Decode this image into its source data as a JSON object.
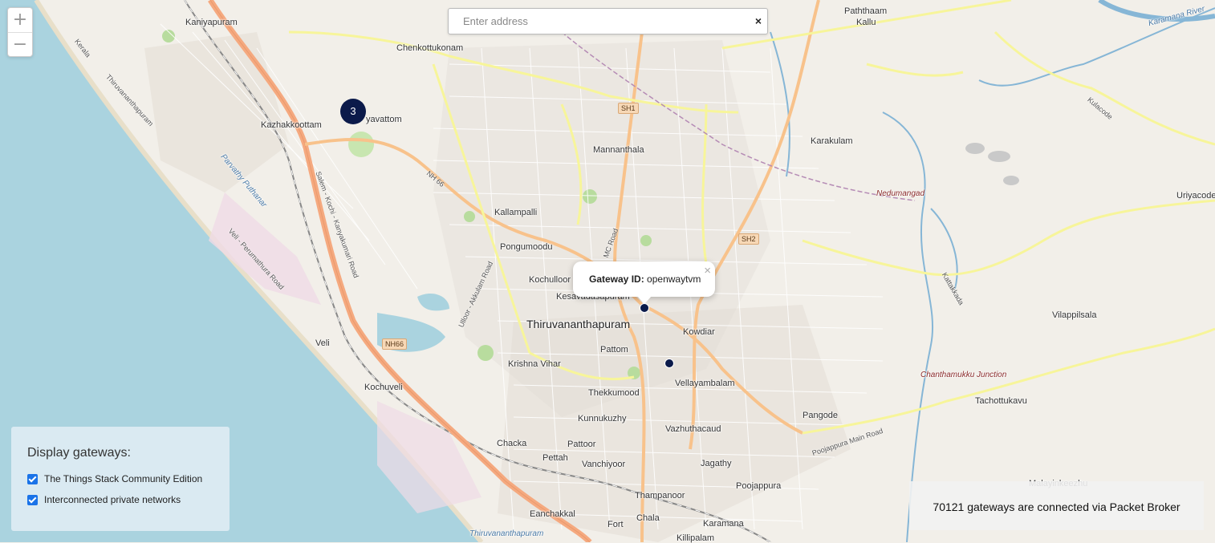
{
  "map": {
    "colors": {
      "land": "#f2efe9",
      "sea": "#aad3df",
      "major_road": "#f5a97f",
      "secondary_road": "#f7f59a",
      "river": "#86b6d6",
      "marker": "#0b1a4a"
    },
    "places": [
      {
        "name": "Kaniyapuram",
        "cls": ""
      },
      {
        "name": "Chenkottukonam",
        "cls": ""
      },
      {
        "name": "Paththaam",
        "cls": ""
      },
      {
        "name": "Kallu",
        "cls": ""
      },
      {
        "name": "Kazhakkoottam",
        "cls": ""
      },
      {
        "name": "yavattom",
        "cls": ""
      },
      {
        "name": "Mannanthala",
        "cls": ""
      },
      {
        "name": "Karakulam",
        "cls": ""
      },
      {
        "name": "Nedumangad",
        "cls": "small-italic"
      },
      {
        "name": "Uriyacode",
        "cls": ""
      },
      {
        "name": "Kallampalli",
        "cls": ""
      },
      {
        "name": "Pongumoodu",
        "cls": ""
      },
      {
        "name": "Kochulloor",
        "cls": ""
      },
      {
        "name": "Kesavadasapuram",
        "cls": ""
      },
      {
        "name": "Thiruvananthapuram",
        "cls": "city"
      },
      {
        "name": "Kowdiar",
        "cls": ""
      },
      {
        "name": "Pattom",
        "cls": ""
      },
      {
        "name": "Veli",
        "cls": ""
      },
      {
        "name": "Krishna Vihar",
        "cls": ""
      },
      {
        "name": "Vilappilsala",
        "cls": ""
      },
      {
        "name": "Vellayambalam",
        "cls": ""
      },
      {
        "name": "Kochuveli",
        "cls": ""
      },
      {
        "name": "Thekkumood",
        "cls": ""
      },
      {
        "name": "Chanthamukku Junction",
        "cls": "small-italic"
      },
      {
        "name": "Tachottukavu",
        "cls": ""
      },
      {
        "name": "Kunnukuzhy",
        "cls": ""
      },
      {
        "name": "Pangode",
        "cls": ""
      },
      {
        "name": "Vazhuthacaud",
        "cls": ""
      },
      {
        "name": "Chacka",
        "cls": ""
      },
      {
        "name": "Pattoor",
        "cls": ""
      },
      {
        "name": "Pettah",
        "cls": ""
      },
      {
        "name": "Vanchiyoor",
        "cls": ""
      },
      {
        "name": "Jagathy",
        "cls": ""
      },
      {
        "name": "Poojappura",
        "cls": ""
      },
      {
        "name": "Malayinkeezhu",
        "cls": ""
      },
      {
        "name": "Thampanoor",
        "cls": ""
      },
      {
        "name": "Eanchakkal",
        "cls": ""
      },
      {
        "name": "Fort",
        "cls": ""
      },
      {
        "name": "Chala",
        "cls": ""
      },
      {
        "name": "Karamana",
        "cls": ""
      },
      {
        "name": "Killipalam",
        "cls": ""
      },
      {
        "name": "Parvathy Puthanar",
        "cls": "water"
      },
      {
        "name": "Karamana River",
        "cls": "water"
      },
      {
        "name": "Thiruvananthapuram",
        "cls": "water"
      }
    ],
    "shields": [
      "SH1",
      "SH2",
      "NH66"
    ],
    "road_labels": [
      "NH 66",
      "MC Road",
      "Veli - Perumathura Road",
      "Salem - Kochi - Kanyakumari Road",
      "Poojappura Main Road",
      "Thiruvananthapuram",
      "Kerala",
      "Kattakkada",
      "Kulacode",
      "Ulloor - Akkulam Road"
    ]
  },
  "zoom": {
    "in_label": "+",
    "out_label": "−"
  },
  "search": {
    "placeholder": "Enter address",
    "clear_label": "×"
  },
  "cluster": {
    "count": "3"
  },
  "popup": {
    "label": "Gateway ID:",
    "value": "openwaytvm",
    "close_label": "×"
  },
  "legend": {
    "title": "Display gateways:",
    "options": [
      {
        "label": "The Things Stack Community Edition",
        "checked": true
      },
      {
        "label": "Interconnected private networks",
        "checked": true
      }
    ]
  },
  "status": {
    "gateways_text": "70121 gateways are connected via Packet Broker"
  }
}
